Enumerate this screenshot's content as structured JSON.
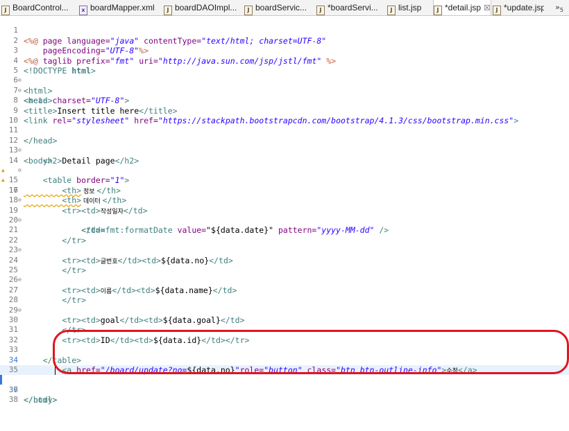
{
  "tabs": [
    {
      "label": "BoardControl...",
      "icon": "java-file-icon"
    },
    {
      "label": "boardMapper.xml",
      "icon": "xml-file-icon"
    },
    {
      "label": "boardDAOImpl...",
      "icon": "java-file-icon"
    },
    {
      "label": "boardServic...",
      "icon": "java-file-icon"
    },
    {
      "label": "*boardServi...",
      "icon": "java-file-icon"
    },
    {
      "label": "list.jsp",
      "icon": "jsp-file-icon"
    },
    {
      "label": "*detail.jsp",
      "icon": "jsp-file-icon"
    },
    {
      "label": "*update.jsp",
      "icon": "jsp-file-icon"
    }
  ],
  "active_tab_close": "☒",
  "overflow_label": "»",
  "overflow_count": "5",
  "line_numbers": [
    "1",
    "2",
    "3",
    "4",
    "5",
    "6",
    "7",
    "8",
    "9",
    "10",
    "11",
    "12",
    "13",
    "14",
    "15",
    "16",
    "17",
    "18",
    "19",
    "20",
    "21",
    "22",
    "23",
    "24",
    "25",
    "26",
    "27",
    "28",
    "29",
    "30",
    "31",
    "32",
    "33",
    "34",
    "35",
    "36",
    "37",
    "38"
  ],
  "code": {
    "l1_p1": "<%@",
    "l1_p2": " page ",
    "l1_p3": "language=",
    "l1_p4": "\"java\"",
    "l1_p5": " contentType=",
    "l1_p6": "\"text/html; charset=UTF-8\"",
    "l2_p1": "    pageEncoding=",
    "l2_p2": "\"UTF-8\"",
    "l2_p3": "%>",
    "l3_p1": "<%@",
    "l3_p2": " taglib ",
    "l3_p3": "prefix=",
    "l3_p4": "\"fmt\"",
    "l3_p5": " uri=",
    "l3_p6": "\"http://java.sun.com/jsp/jstl/fmt\"",
    "l3_p7": " %>",
    "l4_p1": "<!DOCTYPE ",
    "l4_p2": "html",
    "l4_p3": ">",
    "l5": "<html>",
    "l6": "<head>",
    "l7_p1": "<meta ",
    "l7_p2": "charset=",
    "l7_p3": "\"UTF-8\"",
    "l7_p4": ">",
    "l8_p1": "<title>",
    "l8_p2": "Insert title here",
    "l8_p3": "</title>",
    "l9_p1": "<link ",
    "l9_p2": "rel=",
    "l9_p3": "\"stylesheet\"",
    "l9_p4": " href=",
    "l9_p5": "\"https://stackpath.bootstrapcdn.com/bootstrap/4.1.3/css/bootstrap.min.css\"",
    "l9_p6": ">",
    "l11": "</head>",
    "l12": "<body>",
    "l13_p1": "    <h2>",
    "l13_p2": "Detail page",
    "l13_p3": "</h2>",
    "l14_p1": "    <table ",
    "l14_p2": "border=",
    "l14_p3": "\"1\"",
    "l14_p4": ">",
    "l15_p1": "        <th>",
    "l15_p2": " 정보 ",
    "l15_p3": "</th>",
    "l16_p1": "        <th>",
    "l16_p2": " 데이터 ",
    "l16_p3": "</th>",
    "l17": "        <tr>",
    "l18_p1": "            <td>",
    "l18_p2": "작성일자",
    "l18_p3": "</td>",
    "l19_p1": "            <td>",
    "l19_p2": "<fmt:formatDate ",
    "l19_p3": "value=",
    "l19_p4": "\"${data.date}\"",
    "l19_p5": " pattern=",
    "l19_p6": "\"yyyy-MM-dd\"",
    "l19_p7": " />",
    "l20": "            </td>",
    "l21": "        </tr>",
    "l22": "        <tr>",
    "l23_p1": "            <td>",
    "l23_p2": "글번호",
    "l23_p3": "</td><td>",
    "l23_p4": "${data.no}",
    "l23_p5": "</td>",
    "l24": "        </tr>",
    "l25": "        <tr>",
    "l26_p1": "            <td>",
    "l26_p2": "이름",
    "l26_p3": "</td><td>",
    "l26_p4": "${data.name}",
    "l26_p5": "</td>",
    "l27": "        </tr>",
    "l28": "        <tr>",
    "l29_p1": "            <td>",
    "l29_p2": "goal",
    "l29_p3": "</td><td>",
    "l29_p4": "${data.goal}",
    "l29_p5": "</td>",
    "l30": "        </tr>",
    "l31_p1": "        <tr><td>",
    "l31_p2": "ID",
    "l31_p3": "</td><td>",
    "l31_p4": "${data.id}",
    "l31_p5": "</td></tr>",
    "l33": "    </table>",
    "l34_p1": "        <a ",
    "l34_p2": "href=",
    "l34_p3": "\"/board/update?no=",
    "l34_p4": "${data.no}",
    "l34_p5": "\"",
    "l34_p6": "role=",
    "l34_p7": "\"button\"",
    "l34_p8": " class=",
    "l34_p9": "\"btn btn-outline-info\"",
    "l34_p10": ">",
    "l34_p11": "수정",
    "l34_p12": "</a>",
    "l36": "</body>",
    "l37": "</html>"
  },
  "colors": {
    "tag": "#3f7f7f",
    "attribute": "#7f007f",
    "string": "#2a00ff",
    "directive": "#bf5f3f",
    "highlight_ring": "#e0141e",
    "current_line": "#e8f2fe"
  }
}
